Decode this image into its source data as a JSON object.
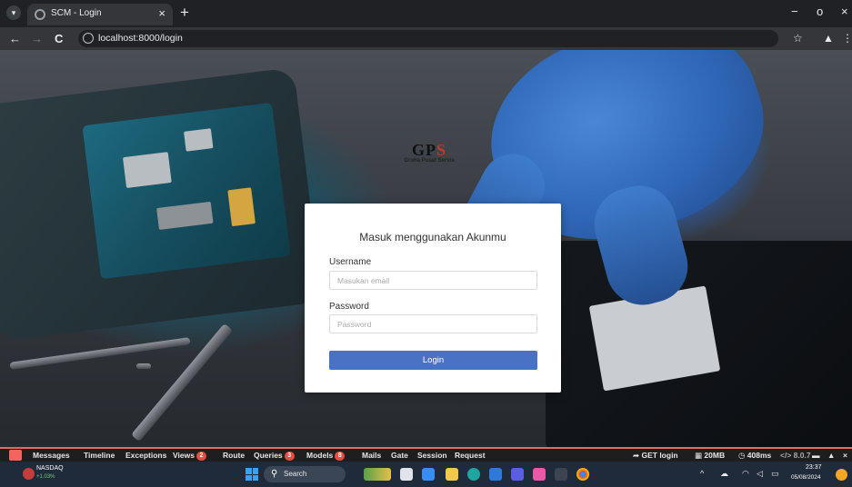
{
  "browser": {
    "tab_title": "SCM - Login",
    "tab_close": "×",
    "new_tab": "+",
    "url": "localhost:8000/login",
    "back": "←",
    "forward": "→",
    "reload": "C",
    "star": "☆",
    "profile": "▲",
    "menu": "⋮",
    "minimize": "−",
    "maximize": "o",
    "close": "×",
    "tab_menu": "▾"
  },
  "logo": {
    "mark_main": "GP",
    "mark_accent": "S",
    "subtitle": "Gruha Pusat Servis"
  },
  "login": {
    "title": "Masuk menggunakan Akunmu",
    "username_label": "Username",
    "username_placeholder": "Masukan email",
    "password_label": "Password",
    "password_placeholder": "Password",
    "button_label": "Login"
  },
  "debugbar": {
    "tabs": [
      {
        "label": "Messages"
      },
      {
        "label": "Timeline"
      },
      {
        "label": "Exceptions"
      },
      {
        "label": "Views",
        "badge": "2"
      },
      {
        "label": "Route"
      },
      {
        "label": "Queries",
        "badge": "3"
      },
      {
        "label": "Models",
        "badge": "8"
      },
      {
        "label": "Mails"
      },
      {
        "label": "Gate"
      },
      {
        "label": "Session"
      },
      {
        "label": "Request"
      }
    ],
    "request": "GET login",
    "memory": "20MB",
    "duration": "408ms",
    "version": "8.0.7",
    "colors": {
      "accent": "#f4645f",
      "badge": "#e74c3c"
    }
  },
  "taskbar": {
    "stock_name": "NASDAQ",
    "stock_change": "+1.03%",
    "search_label": "Search",
    "search_icon": "magnifier-icon",
    "time": "23:37",
    "date": "05/08/2024",
    "tray_caret": "^",
    "apps": [
      "widgets-icon",
      "file-explorer-icon",
      "store-icon",
      "folder-icon",
      "edge-icon",
      "calendar-icon",
      "vscode-icon",
      "photos-icon",
      "terminal-icon",
      "chrome-icon"
    ]
  }
}
